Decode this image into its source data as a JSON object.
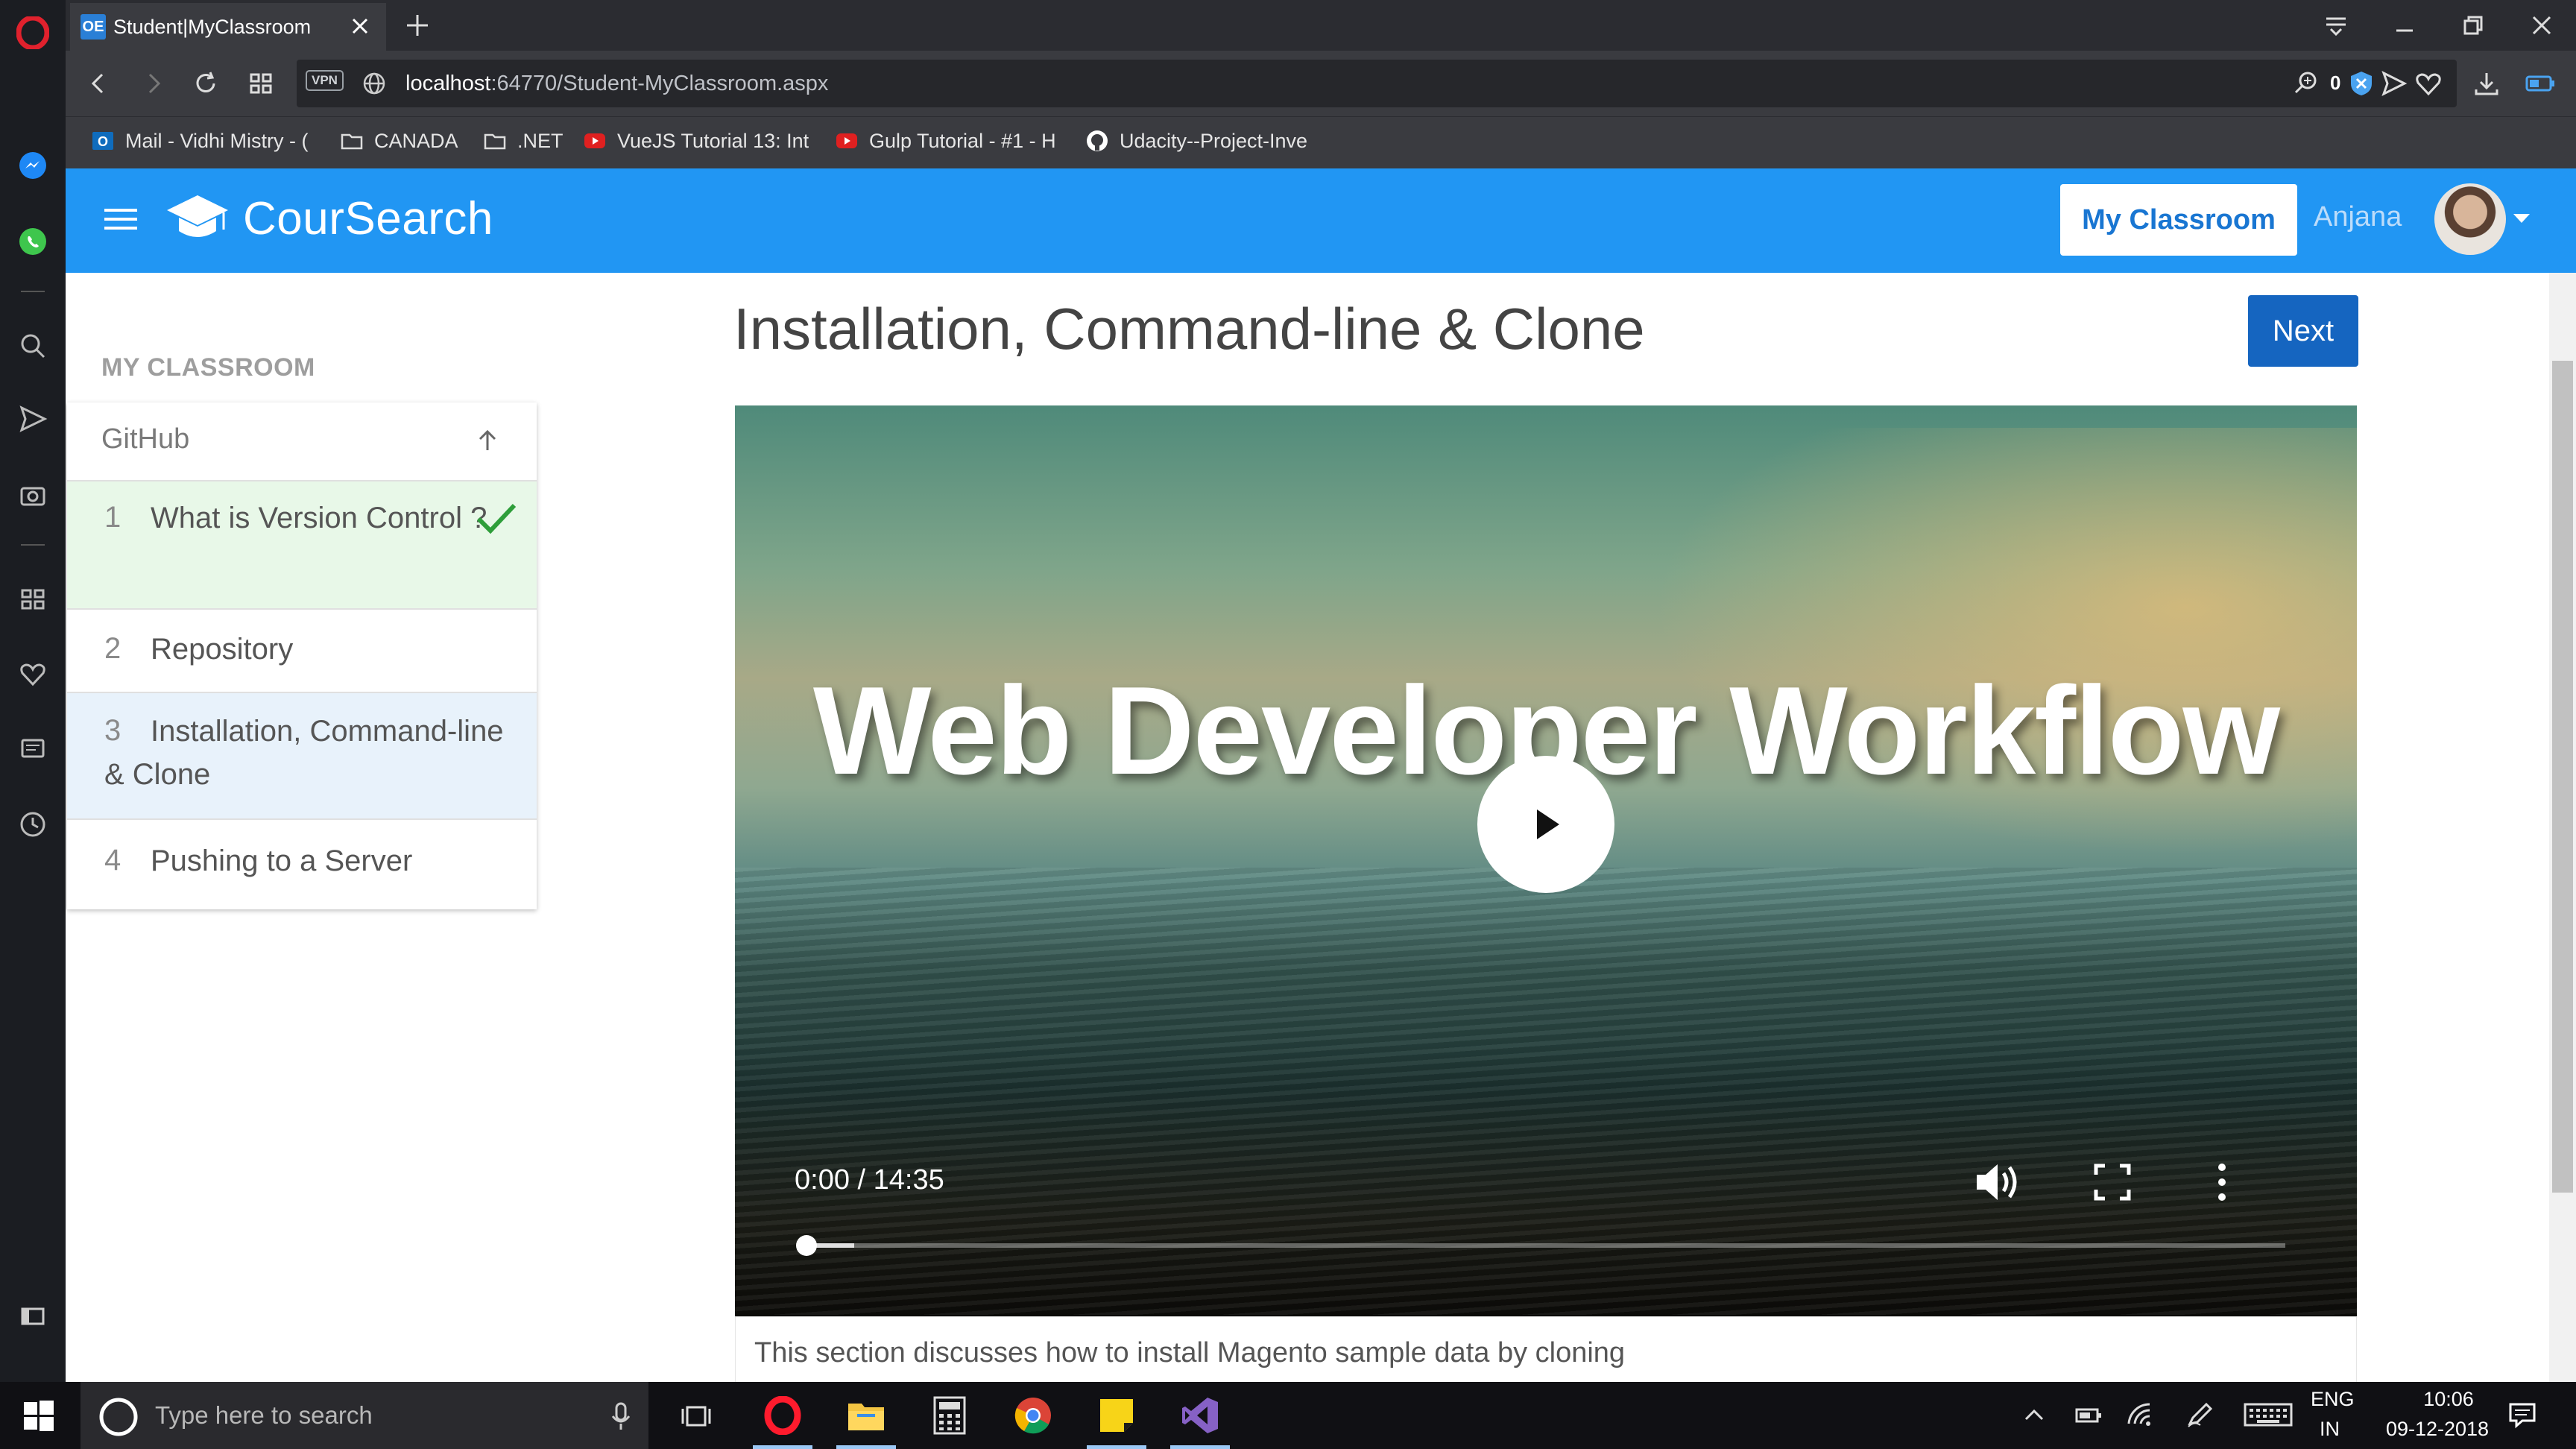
{
  "browser": {
    "tab_title": "Student|MyClassroom",
    "tab_favicon": "OE",
    "url_host": "localhost",
    "url_path": ":64770/Student-MyClassroom.aspx",
    "vpn_label": "VPN",
    "ad_block_count": "0",
    "bookmarks": [
      {
        "label": "Mail - Vidhi Mistry - (",
        "icon": "outlook-icon"
      },
      {
        "label": "CANADA",
        "icon": "folder-icon"
      },
      {
        "label": ".NET",
        "icon": "folder-icon"
      },
      {
        "label": "VueJS Tutorial 13: Int",
        "icon": "youtube-icon"
      },
      {
        "label": "Gulp Tutorial - #1 - H",
        "icon": "youtube-icon"
      },
      {
        "label": "Udacity--Project-Inve",
        "icon": "github-icon"
      }
    ]
  },
  "header": {
    "brand": "CourSearch",
    "classroom_button": "My Classroom",
    "user_name": "Anjana"
  },
  "sidebar": {
    "heading": "MY CLASSROOM",
    "course": "GitHub",
    "lessons": [
      {
        "num": "1",
        "title": "What is Version Control ?",
        "completed": true
      },
      {
        "num": "2",
        "title": "Repository",
        "completed": false
      },
      {
        "num": "3",
        "title": "Installation, Command-line & Clone",
        "completed": false,
        "active": true
      },
      {
        "num": "4",
        "title": "Pushing to a Server",
        "completed": false
      }
    ]
  },
  "main": {
    "lesson_title": "Installation, Command-line & Clone",
    "next_button": "Next",
    "video": {
      "heading": "Web Developer Workflow",
      "time": "0:00 / 14:35",
      "progress": 0
    },
    "description": "This section discusses how to install Magento sample data by cloning"
  },
  "taskbar": {
    "search_placeholder": "Type here to search",
    "lang_line1": "ENG",
    "lang_line2": "IN",
    "time": "10:06",
    "date": "09-12-2018"
  },
  "colors": {
    "app_bar": "#2196f3",
    "next_button": "#1565c0",
    "completed_bg": "#e8f8e8",
    "active_bg": "#e8f2fb",
    "check": "#2e9e3a"
  }
}
